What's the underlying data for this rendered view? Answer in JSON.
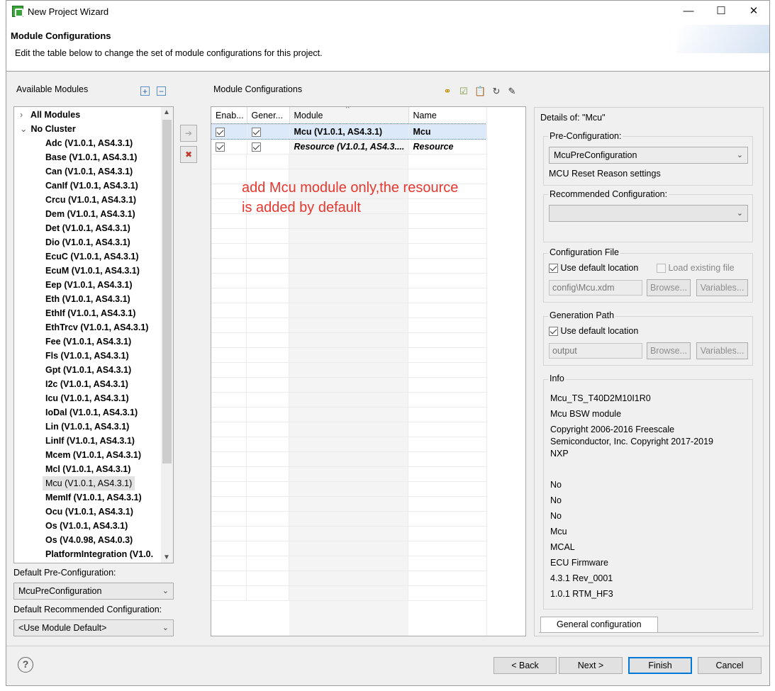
{
  "window": {
    "title": "New Project Wizard",
    "minimize": "—",
    "maximize": "☐",
    "close": "✕"
  },
  "header": {
    "title": "Module Configurations",
    "subtitle": "Edit the table below to change the set of module configurations for this project."
  },
  "available": {
    "label": "Available Modules",
    "all_modules": "All Modules",
    "no_cluster": "No Cluster",
    "items": [
      "Adc (V1.0.1, AS4.3.1)",
      "Base (V1.0.1, AS4.3.1)",
      "Can (V1.0.1, AS4.3.1)",
      "CanIf (V1.0.1, AS4.3.1)",
      "Crcu (V1.0.1, AS4.3.1)",
      "Dem (V1.0.1, AS4.3.1)",
      "Det (V1.0.1, AS4.3.1)",
      "Dio (V1.0.1, AS4.3.1)",
      "EcuC (V1.0.1, AS4.3.1)",
      "EcuM (V1.0.1, AS4.3.1)",
      "Eep (V1.0.1, AS4.3.1)",
      "Eth (V1.0.1, AS4.3.1)",
      "EthIf (V1.0.1, AS4.3.1)",
      "EthTrcv (V1.0.1, AS4.3.1)",
      "Fee (V1.0.1, AS4.3.1)",
      "Fls (V1.0.1, AS4.3.1)",
      "Gpt (V1.0.1, AS4.3.1)",
      "I2c (V1.0.1, AS4.3.1)",
      "Icu (V1.0.1, AS4.3.1)",
      "IoDal (V1.0.1, AS4.3.1)",
      "Lin (V1.0.1, AS4.3.1)",
      "LinIf (V1.0.1, AS4.3.1)",
      "Mcem (V1.0.1, AS4.3.1)",
      "Mcl (V1.0.1, AS4.3.1)",
      "Mcu (V1.0.1, AS4.3.1)",
      "MemIf (V1.0.1, AS4.3.1)",
      "Ocu (V1.0.1, AS4.3.1)",
      "Os (V1.0.1, AS4.3.1)",
      "Os (V4.0.98, AS4.0.3)",
      "PlatformIntegration (V1.0."
    ],
    "selected_index": 24
  },
  "defaults": {
    "preconfig_label": "Default Pre-Configuration:",
    "preconfig_value": "McuPreConfiguration",
    "recommended_label": "Default Recommended Configuration:",
    "recommended_value": "<Use Module Default>"
  },
  "configs": {
    "label": "Module Configurations",
    "columns": [
      "Enab...",
      "Gener...",
      "Module",
      "Name"
    ],
    "rows": [
      {
        "module": "Mcu (V1.0.1, AS4.3.1)",
        "name": "Mcu"
      },
      {
        "module": "Resource (V1.0.1, AS4.3....",
        "name": "Resource"
      }
    ],
    "note_line1": "add Mcu module only,the resource",
    "note_line2": "is added by default"
  },
  "details": {
    "title": "Details of: \"Mcu\"",
    "preconfig_group": "Pre-Configuration:",
    "preconfig_value": "McuPreConfiguration",
    "preconfig_desc": "MCU Reset Reason settings",
    "recommended_group": "Recommended Configuration:",
    "config_file_group": "Configuration File",
    "use_default_location": "Use default location",
    "load_existing_file": "Load existing file",
    "config_file_value": "config\\Mcu.xdm",
    "browse": "Browse...",
    "variables": "Variables...",
    "generation_path_group": "Generation Path",
    "generation_path_value": "output",
    "info_group": "Info",
    "info_lines": [
      "Mcu_TS_T40D2M10I1R0",
      "Mcu BSW module",
      "Copyright 2006-2016 Freescale",
      "Semiconductor, Inc.  Copyright 2017-2019",
      "NXP"
    ],
    "info_values": [
      "No",
      "No",
      "No",
      "Mcu",
      "MCAL",
      "ECU Firmware",
      "4.3.1 Rev_0001",
      "1.0.1 RTM_HF3"
    ],
    "tab_label": "General configuration"
  },
  "footer": {
    "help": "?",
    "back": "< Back",
    "next": "Next >",
    "finish": "Finish",
    "cancel": "Cancel"
  }
}
